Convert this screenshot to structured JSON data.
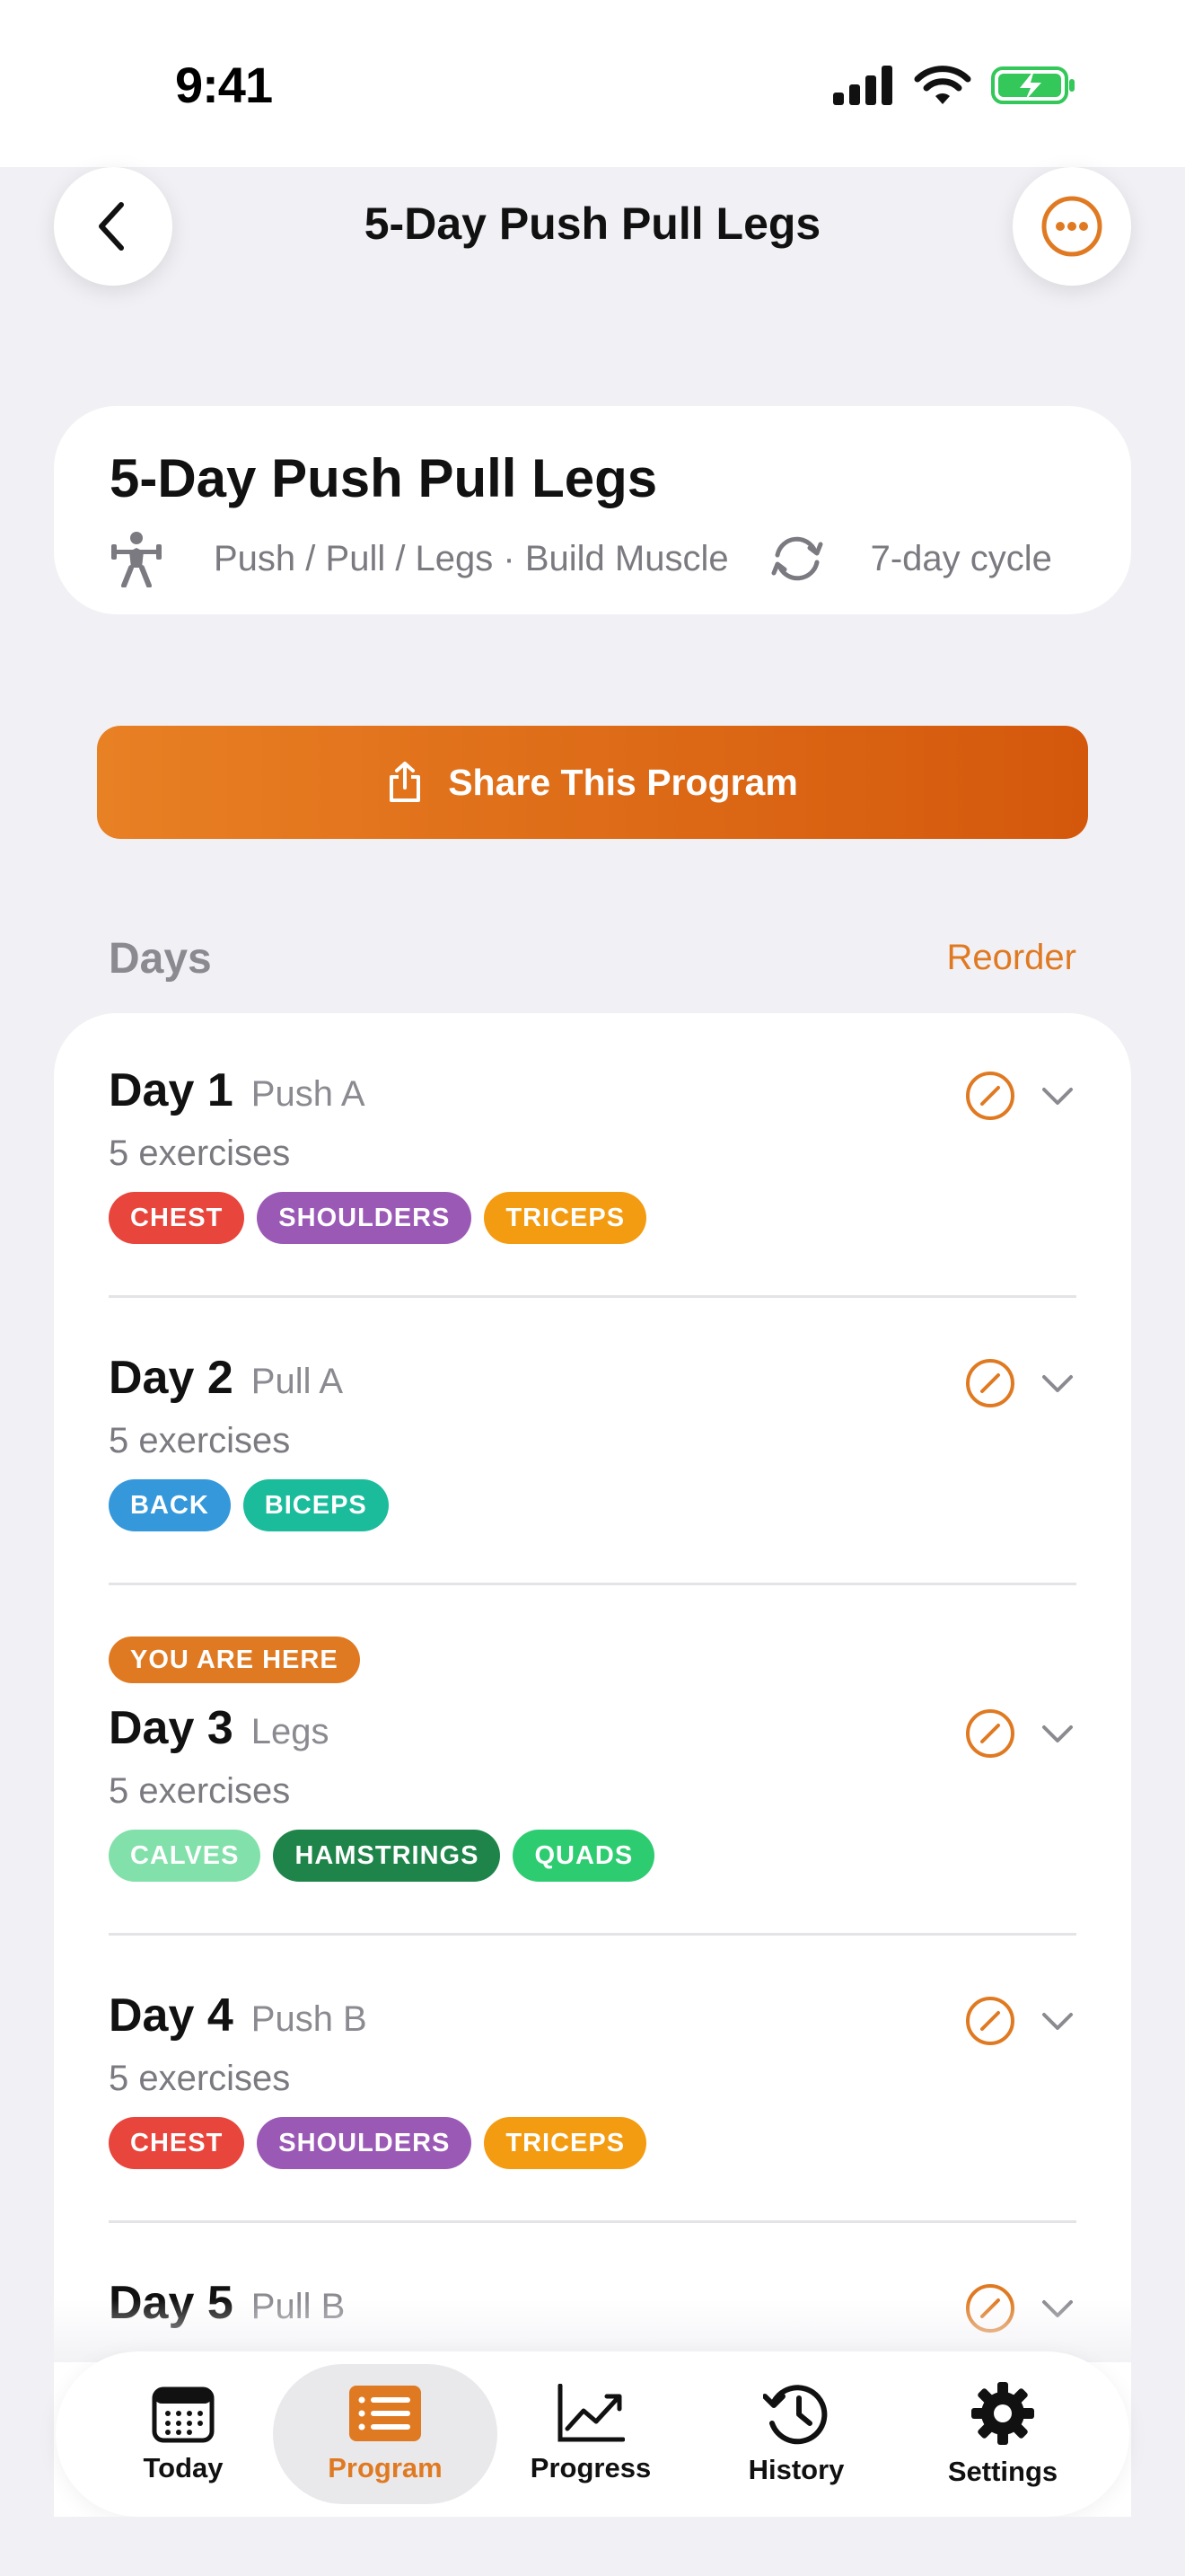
{
  "status_bar": {
    "time": "9:41"
  },
  "nav": {
    "title": "5-Day Push Pull Legs",
    "back_icon": "chevron-left-icon",
    "more_icon": "ellipsis-circle-icon"
  },
  "program": {
    "title": "5-Day Push Pull Legs",
    "meta": "Push / Pull / Legs · Build Muscle",
    "cycle": "7-day cycle"
  },
  "share_button": {
    "label": "Share This Program",
    "icon": "share-icon"
  },
  "days_section": {
    "label": "Days",
    "reorder": "Reorder"
  },
  "you_are_here": "YOU ARE HERE",
  "days": [
    {
      "label": "Day 1",
      "name": "Push A",
      "count": "5 exercises",
      "tags": [
        {
          "text": "CHEST",
          "color": "#e8453c"
        },
        {
          "text": "SHOULDERS",
          "color": "#9b59b6"
        },
        {
          "text": "TRICEPS",
          "color": "#f39c12"
        }
      ]
    },
    {
      "label": "Day 2",
      "name": "Pull A",
      "count": "5 exercises",
      "tags": [
        {
          "text": "BACK",
          "color": "#3498db"
        },
        {
          "text": "BICEPS",
          "color": "#1abc9c"
        }
      ]
    },
    {
      "label": "Day 3",
      "name": "Legs",
      "count": "5 exercises",
      "current": true,
      "tags": [
        {
          "text": "CALVES",
          "color": "#82e0aa"
        },
        {
          "text": "HAMSTRINGS",
          "color": "#1e8449"
        },
        {
          "text": "QUADS",
          "color": "#2ecc71"
        }
      ]
    },
    {
      "label": "Day 4",
      "name": "Push B",
      "count": "5 exercises",
      "tags": [
        {
          "text": "CHEST",
          "color": "#e8453c"
        },
        {
          "text": "SHOULDERS",
          "color": "#9b59b6"
        },
        {
          "text": "TRICEPS",
          "color": "#f39c12"
        }
      ]
    },
    {
      "label": "Day 5",
      "name": "Pull B"
    }
  ],
  "tab_bar": {
    "items": [
      {
        "label": "Today",
        "icon": "calendar-icon"
      },
      {
        "label": "Program",
        "icon": "list-icon",
        "active": true
      },
      {
        "label": "Progress",
        "icon": "chart-icon"
      },
      {
        "label": "History",
        "icon": "clock-history-icon"
      },
      {
        "label": "Settings",
        "icon": "gear-icon"
      }
    ]
  },
  "colors": {
    "accent": "#e07a22",
    "background": "#f1f1f5"
  }
}
